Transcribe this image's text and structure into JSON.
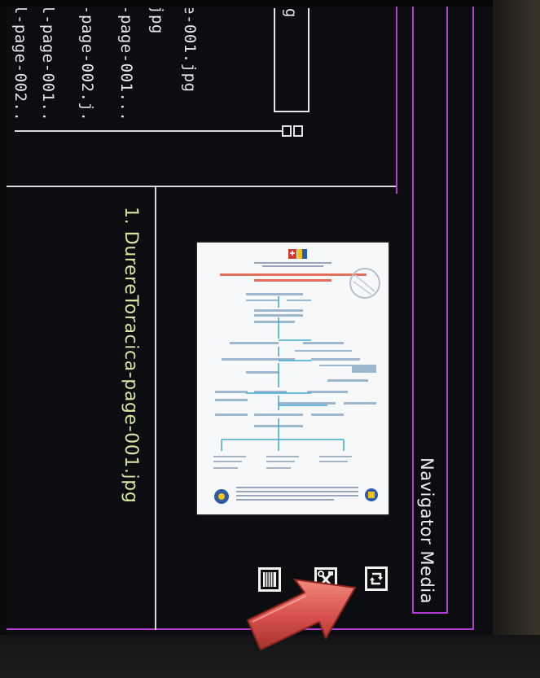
{
  "file_list": {
    "items": [
      "l-page-002...",
      "l-page-001...",
      "-page-002.j...",
      "-page-001...",
      "jpg",
      "e-001.jpg"
    ],
    "search_value": "g"
  },
  "media": {
    "selected_file": "1. DurereToracica-page-001.jpg"
  },
  "navigator": {
    "title": "Navigator Media"
  },
  "toolbar": {
    "icons": [
      "book-icon",
      "tools-icon",
      "rotate-icon"
    ]
  },
  "colors": {
    "frame": "#b43cd0",
    "title_text": "#d7e6a4",
    "arrow": "#d9534f"
  }
}
